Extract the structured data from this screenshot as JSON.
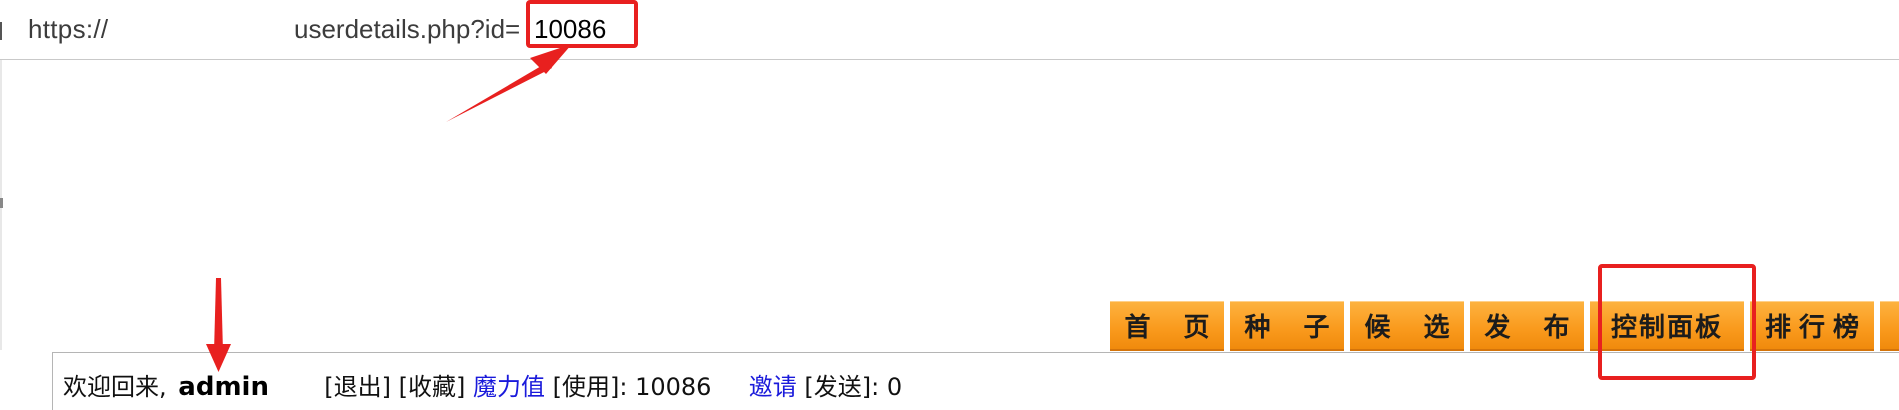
{
  "browser": {
    "url_scheme": "https://",
    "url_path": "userdetails.php?id=",
    "url_id": "10086"
  },
  "nav": {
    "items": [
      {
        "label": "首 页"
      },
      {
        "label": "种 子"
      },
      {
        "label": "候 选"
      },
      {
        "label": "发 布"
      },
      {
        "label": "控制面板"
      },
      {
        "label": "排行榜"
      }
    ]
  },
  "info": {
    "welcome": "欢迎回来,",
    "username": "admin",
    "logout": "[退出]",
    "bookmarks": "[收藏]",
    "bonus_label": "魔力值",
    "bonus_use": "[使用]:",
    "bonus_value": "10086",
    "invite_label": "邀请",
    "invite_send": "[发送]:",
    "invite_value": "0"
  },
  "colors": {
    "annotation": "#e8201f",
    "nav_orange": "#fa9b1e",
    "link_blue": "#1a1adb"
  },
  "annotations": {
    "icons": [
      "arrow-to-url-id-icon",
      "arrow-to-username-icon"
    ]
  }
}
